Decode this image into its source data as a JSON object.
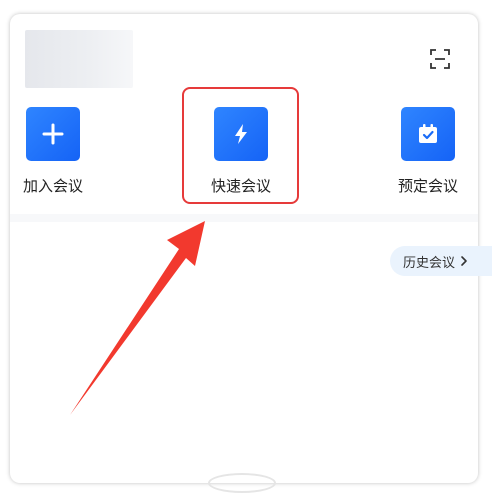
{
  "header": {
    "avatar_icon": "avatar-placeholder",
    "scan_icon": "scan-icon"
  },
  "actions": [
    {
      "label": "加入会议",
      "icon": "plus-icon"
    },
    {
      "label": "快速会议",
      "icon": "lightning-icon"
    },
    {
      "label": "预定会议",
      "icon": "calendar-check-icon"
    }
  ],
  "history": {
    "label": "历史会议",
    "icon": "chevron-right-icon"
  },
  "colors": {
    "accent": "#1a6cf7",
    "highlight": "#e63a3a",
    "annotation_arrow": "#f2392e",
    "history_bg": "#eaf3fd"
  }
}
